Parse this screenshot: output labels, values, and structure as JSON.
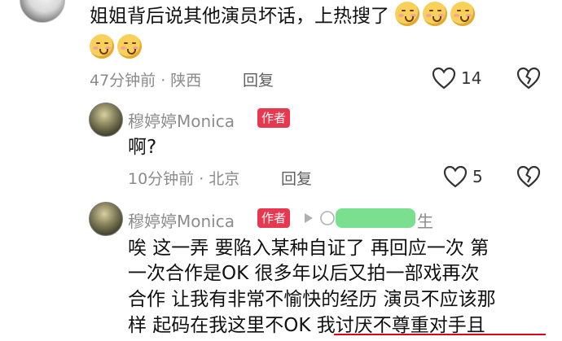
{
  "comment_main": {
    "text": "姐姐背后说其他演员坏话，上热搜了",
    "time_location": "47分钟前 · 陕西",
    "reply_label": "回复",
    "like_count": "14"
  },
  "reply_1": {
    "username": "穆婷婷Monica",
    "author_badge": "作者",
    "text": "啊?",
    "time_location": "10分钟前 · 北京",
    "reply_label": "回复",
    "like_count": "5"
  },
  "reply_2": {
    "username": "穆婷婷Monica",
    "author_badge": "作者",
    "reply_to_fragment": "生",
    "lines": [
      "唉 这一弄 要陷入某种自证了 再回应一次 第",
      "一次合作是OK 很多年以后又拍一部戏再次",
      "合作 让我有非常不愉快的经历 演员不应该那",
      "样 起码在我这里不OK 我讨厌不尊重对手且"
    ]
  },
  "icons": {
    "like": "heart-outline-icon",
    "dislike": "broken-heart-icon",
    "arrow": "play-arrow-icon"
  },
  "colors": {
    "badge": "#e8384f",
    "underline": "#e0001c",
    "mask": "#6fdc86"
  }
}
